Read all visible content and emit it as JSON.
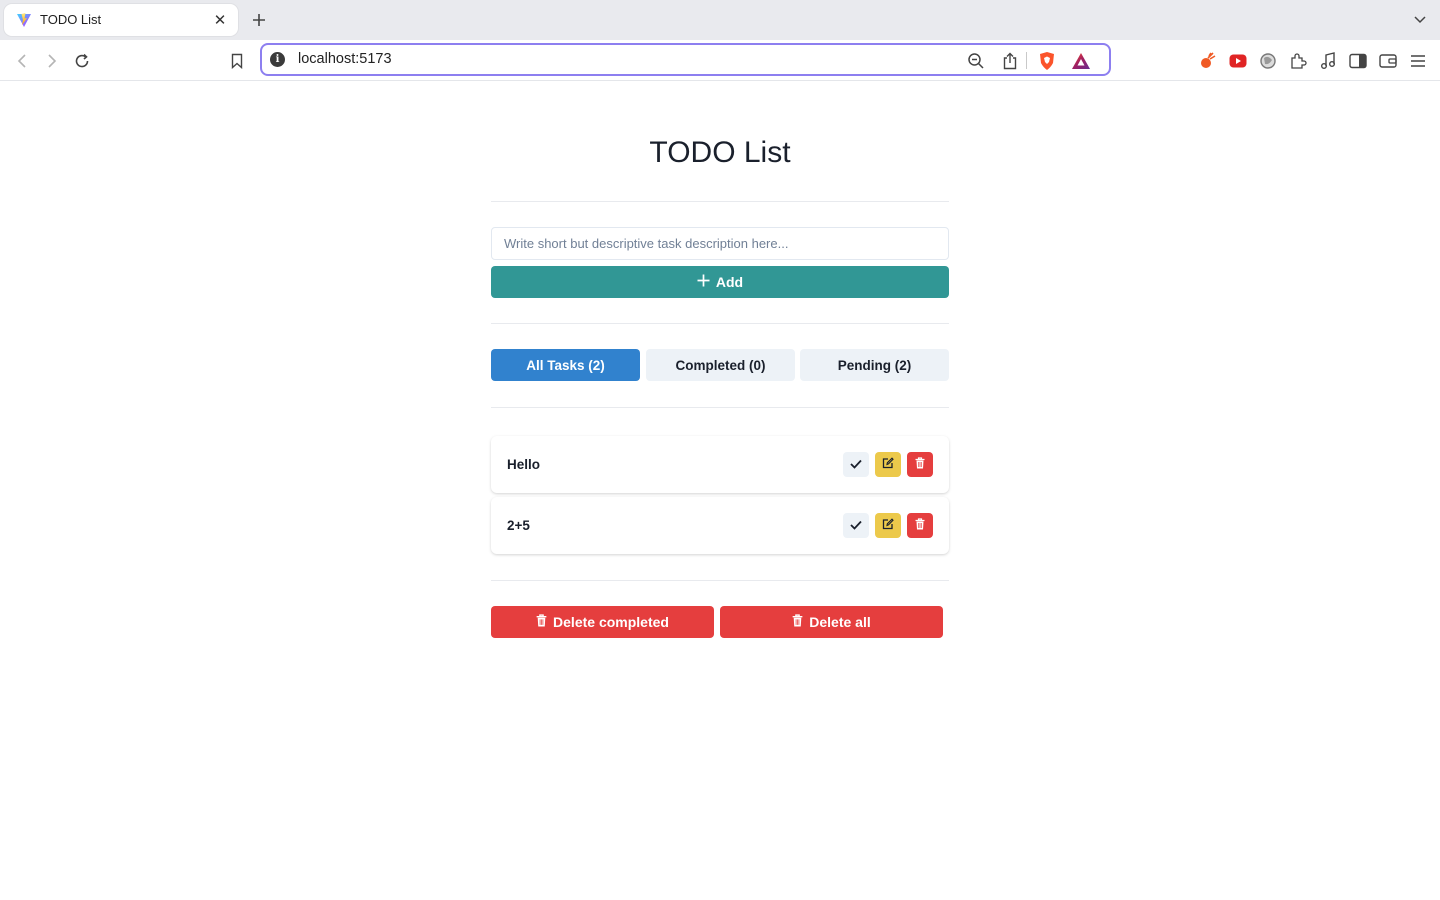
{
  "browser": {
    "tab_title": "TODO List",
    "url": "localhost:5173"
  },
  "app": {
    "title": "TODO List",
    "input_placeholder": "Write short but descriptive task description here...",
    "add_label": "Add",
    "filters": [
      {
        "label": "All Tasks (2)",
        "active": true
      },
      {
        "label": "Completed (0)",
        "active": false
      },
      {
        "label": "Pending (2)",
        "active": false
      }
    ],
    "tasks": [
      {
        "text": "Hello"
      },
      {
        "text": "2+5"
      }
    ],
    "delete_completed_label": "Delete completed",
    "delete_all_label": "Delete all"
  },
  "colors": {
    "teal": "#319795",
    "blue": "#3182ce",
    "red": "#e53e3e",
    "yellow": "#ecc94b",
    "url_focus": "#8d7ff0"
  },
  "icons": [
    "vite-icon",
    "close-icon",
    "plus-icon",
    "chevron-down-icon",
    "back-icon",
    "forward-icon",
    "reload-icon",
    "bookmark-icon",
    "info-icon",
    "zoom-out-icon",
    "share-icon",
    "brave-shield-icon",
    "brave-rewards-icon",
    "leo-icon",
    "youtube-icon",
    "vpn-icon",
    "extensions-icon",
    "music-icon",
    "sidebar-icon",
    "wallet-icon",
    "menu-icon",
    "check-icon",
    "edit-icon",
    "trash-icon"
  ]
}
